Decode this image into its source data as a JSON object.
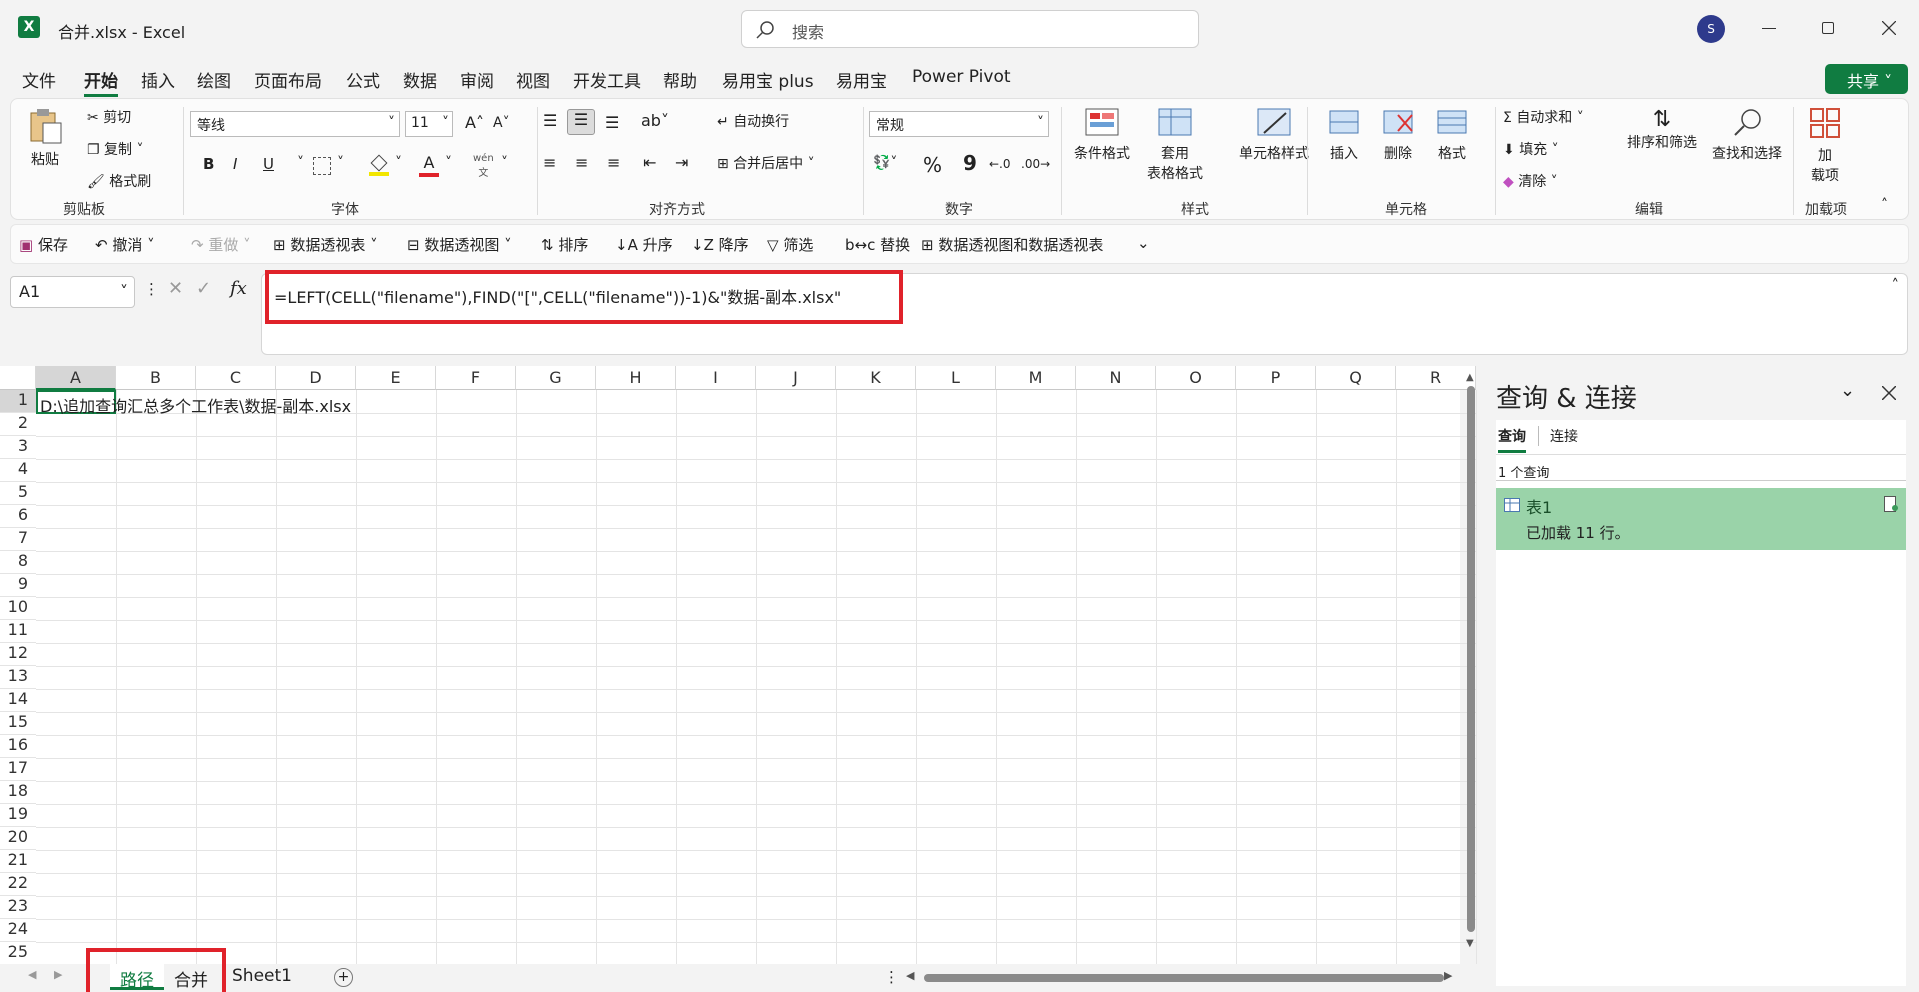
{
  "titlebar": {
    "title": "合并.xlsx  -  Excel",
    "search_placeholder": "搜索",
    "avatar_initial": "S"
  },
  "menubar": {
    "items": [
      "文件",
      "开始",
      "插入",
      "绘图",
      "页面布局",
      "公式",
      "数据",
      "审阅",
      "视图",
      "开发工具",
      "帮助",
      "易用宝 plus",
      "易用宝",
      "Power Pivot"
    ],
    "share_label": "共享"
  },
  "ribbon": {
    "clipboard": {
      "paste": "粘贴",
      "cut": "剪切",
      "copy": "复制",
      "format_painter": "格式刷",
      "label": "剪贴板"
    },
    "font": {
      "font_name": "等线",
      "font_size": "11",
      "bold": "B",
      "italic": "I",
      "underline": "U",
      "phonetic": "wén",
      "label": "字体"
    },
    "alignment": {
      "wrap": "自动换行",
      "merge": "合并后居中",
      "label": "对齐方式"
    },
    "number": {
      "format": "常规",
      "percent": "%",
      "comma": "9",
      "label": "数字"
    },
    "styles": {
      "conditional": "条件格式",
      "table_fmt_1": "套用",
      "table_fmt_2": "表格格式",
      "cell_styles": "单元格样式",
      "label": "样式"
    },
    "cells": {
      "insert": "插入",
      "delete": "删除",
      "format": "格式",
      "label": "单元格"
    },
    "editing": {
      "autosum": "自动求和",
      "fill": "填充",
      "clear": "清除",
      "sort_filter": "排序和筛选",
      "find_select": "查找和选择",
      "label": "编辑"
    },
    "addins": {
      "btn_1": "加",
      "btn_2": "载项",
      "label": "加载项"
    }
  },
  "qat": {
    "items": [
      "保存",
      "撤消",
      "重做",
      "数据透视表",
      "数据透视图",
      "排序",
      "升序",
      "降序",
      "筛选",
      "替换",
      "数据透视图和数据透视表"
    ]
  },
  "formula_bar": {
    "name_box": "A1",
    "fx": "fx",
    "formula": "=LEFT(CELL(\"filename\"),FIND(\"[\",CELL(\"filename\"))-1)&\"数据-副本.xlsx\""
  },
  "grid": {
    "columns": [
      "A",
      "B",
      "C",
      "D",
      "E",
      "F",
      "G",
      "H",
      "I",
      "J",
      "K",
      "L",
      "M",
      "N",
      "O",
      "P",
      "Q",
      "R"
    ],
    "rows": [
      "1",
      "2",
      "3",
      "4",
      "5",
      "6",
      "7",
      "8",
      "9",
      "10",
      "11",
      "12",
      "13",
      "14",
      "15",
      "16",
      "17",
      "18",
      "19",
      "20",
      "21",
      "22",
      "23",
      "24",
      "25"
    ],
    "a1_value": "D:\\追加查询汇总多个工作表\\数据-副本.xlsx"
  },
  "sheet_tabs": [
    "路径",
    "合并",
    "Sheet1"
  ],
  "queries_panel": {
    "title": "查询 & 连接",
    "tab_queries": "查询",
    "tab_connections": "连接",
    "count": "1 个查询",
    "query_name": "表1",
    "query_status": "已加载 11 行。"
  },
  "colors": {
    "excel_green": "#107c41",
    "selected_query": "#9ad3a9",
    "red_highlight": "#e0222a"
  }
}
